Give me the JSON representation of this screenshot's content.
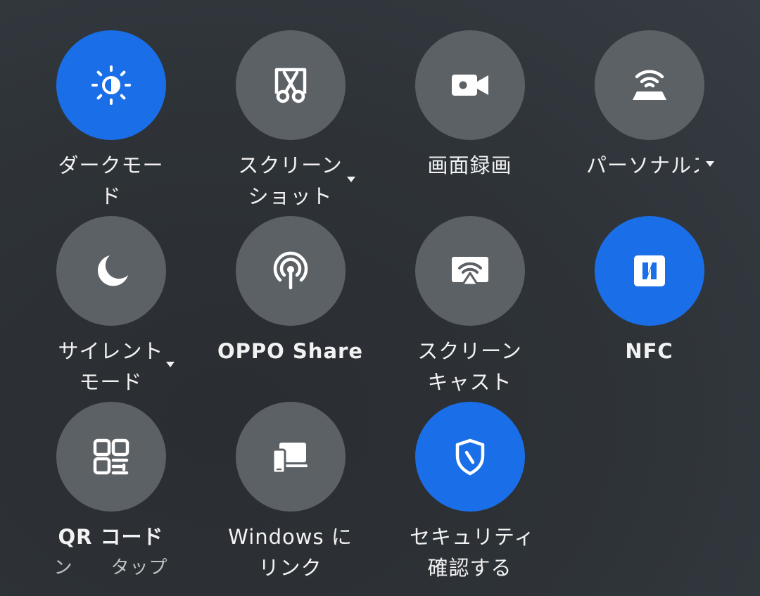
{
  "tiles": [
    {
      "line1": "ダークモー",
      "line2": "ド",
      "icon": "brightness-half-icon",
      "active": true
    },
    {
      "line1": "スクリーン",
      "line2": "ショット",
      "icon": "screenshot-scissors-icon",
      "active": false
    },
    {
      "line1": "画面録画",
      "line2": "",
      "icon": "video-camera-icon",
      "active": false
    },
    {
      "line1": "パーソナルス",
      "line2": "",
      "icon": "personal-hotspot-icon",
      "active": false
    },
    {
      "line1": "サイレント",
      "line2": "モード",
      "icon": "moon-icon",
      "active": false
    },
    {
      "line1": "OPPO Share",
      "line2": "",
      "icon": "broadcast-antenna-icon",
      "active": false
    },
    {
      "line1": "スクリーン",
      "line2": "キャスト",
      "icon": "screen-cast-icon",
      "active": false
    },
    {
      "line1": "NFC",
      "line2": "",
      "icon": "nfc-icon",
      "active": true
    },
    {
      "line1": "QR コード",
      "line2": "ン　　タップ",
      "icon": "qr-code-icon",
      "active": false
    },
    {
      "line1": "Windows に",
      "line2": "リンク",
      "icon": "link-to-windows-icon",
      "active": false
    },
    {
      "line1": "セキュリティ",
      "line2": "確認する",
      "icon": "security-shield-icon",
      "active": true
    }
  ]
}
